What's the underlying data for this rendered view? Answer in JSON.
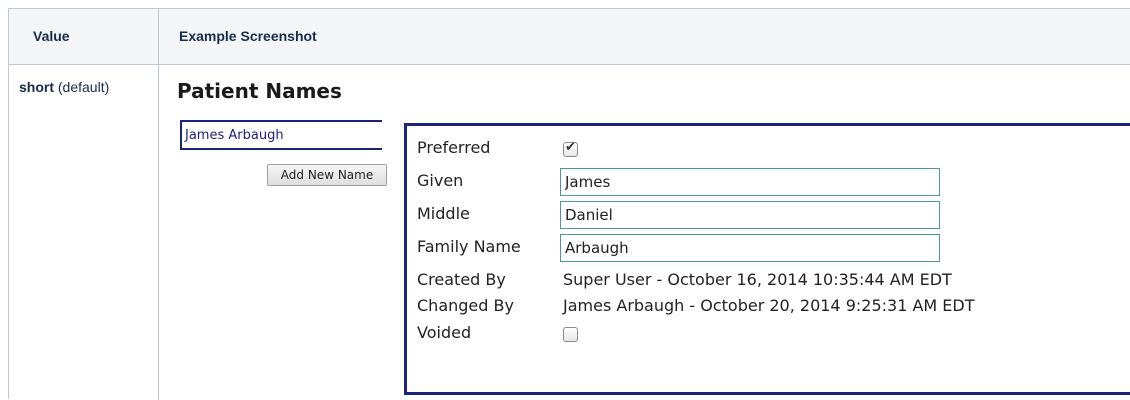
{
  "table": {
    "header_value": "Value",
    "header_example": "Example Screenshot",
    "row_value_bold": "short",
    "row_value_suffix": " (default)"
  },
  "screenshot": {
    "title": "Patient Names",
    "names_list": [
      "James Arbaugh"
    ],
    "add_button_label": "Add New Name",
    "fields": {
      "preferred_label": "Preferred",
      "preferred_checked": true,
      "given_label": "Given",
      "given_value": "James",
      "middle_label": "Middle",
      "middle_value": "Daniel",
      "family_label": "Family Name",
      "family_value": "Arbaugh",
      "created_label": "Created By",
      "created_value": "Super User - October 16, 2014 10:35:44 AM EDT",
      "changed_label": "Changed By",
      "changed_value": "James Arbaugh - October 20, 2014 9:25:31 AM EDT",
      "voided_label": "Voided",
      "voided_checked": false
    }
  }
}
